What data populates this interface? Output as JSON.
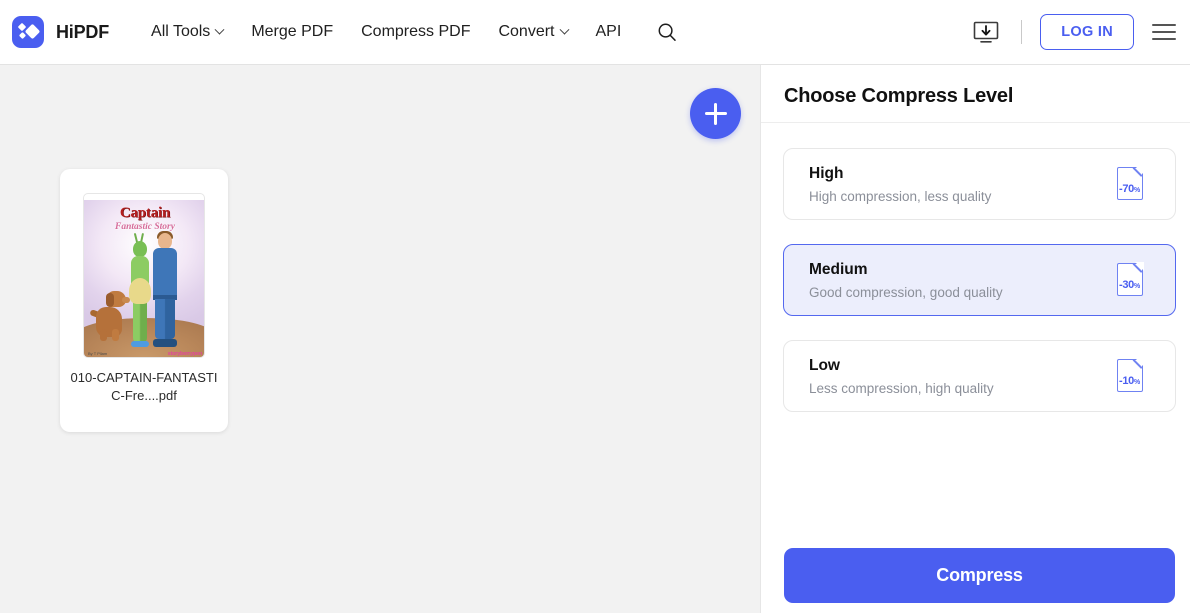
{
  "header": {
    "brand_name": "HiPDF",
    "logo_icon": "hipdf-diamond-logo",
    "nav_items": [
      {
        "label": "All Tools",
        "has_chevron": true
      },
      {
        "label": "Merge PDF",
        "has_chevron": false
      },
      {
        "label": "Compress PDF",
        "has_chevron": false
      },
      {
        "label": "Convert",
        "has_chevron": true
      },
      {
        "label": "API",
        "has_chevron": false
      }
    ],
    "search_icon": "search-icon",
    "desktop_download_icon": "desktop-download-icon",
    "login_label": "LOG IN",
    "menu_icon": "hamburger-menu-icon",
    "accent_color": "#4a5ef0"
  },
  "workspace": {
    "add_file_button_icon": "plus-icon",
    "background_color": "#f2f2f2",
    "file": {
      "name": "010-CAPTAIN-FANTASTIC-Fre....pdf",
      "thumbnail": {
        "title": "Captain",
        "subtitle": "Fantastic Story",
        "credit": "By T Pllam",
        "brand": "storyberrypen"
      }
    }
  },
  "panel": {
    "title": "Choose Compress Level",
    "options": [
      {
        "title": "High",
        "description": "High compression, less quality",
        "badge": "-70",
        "badge_symbol": "%",
        "selected": false,
        "icon": "document-percent-icon"
      },
      {
        "title": "Medium",
        "description": "Good compression, good quality",
        "badge": "-30",
        "badge_symbol": "%",
        "selected": true,
        "icon": "document-percent-icon"
      },
      {
        "title": "Low",
        "description": "Less compression, high quality",
        "badge": "-10",
        "badge_symbol": "%",
        "selected": false,
        "icon": "document-percent-icon"
      }
    ],
    "submit_label": "Compress",
    "selected_bg_color": "#eceefc",
    "selected_border_color": "#5468ef"
  }
}
